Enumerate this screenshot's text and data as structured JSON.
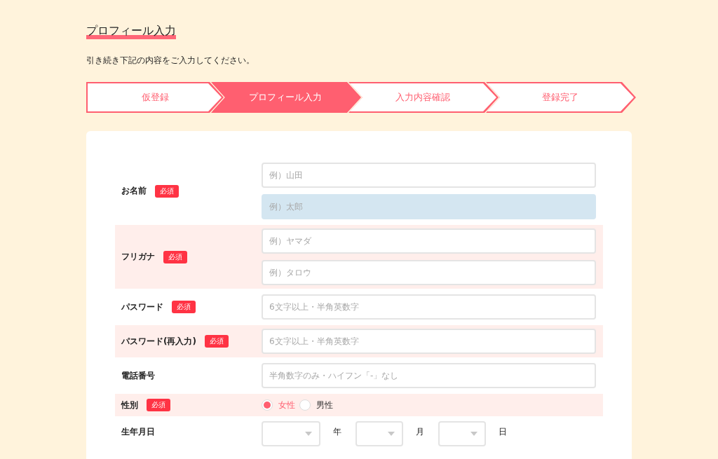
{
  "heading": "プロフィール入力",
  "intro": "引き続き下記の内容をご入力してください。",
  "steps": [
    {
      "label": "仮登録",
      "selected": false
    },
    {
      "label": "プロフィール入力",
      "selected": true
    },
    {
      "label": "入力内容確認",
      "selected": false
    },
    {
      "label": "登録完了",
      "selected": false
    }
  ],
  "form": {
    "rows": [
      {
        "kind": "text",
        "label": "お名前",
        "required_badge": "必須",
        "fields": [
          {
            "placeholder": "例）山田",
            "focused": false
          },
          {
            "placeholder": "例）太郎",
            "focused": true
          }
        ]
      },
      {
        "kind": "text",
        "label": "フリガナ",
        "required_badge": "必須",
        "fields": [
          {
            "placeholder": "例）ヤマダ",
            "focused": false
          },
          {
            "placeholder": "例）タロウ",
            "focused": false
          }
        ]
      },
      {
        "kind": "text",
        "label": "パスワード",
        "required_badge": "必須",
        "fields": [
          {
            "placeholder": "6文字以上・半角英数字",
            "focused": false
          }
        ]
      },
      {
        "kind": "text",
        "label": "パスワード(再入力)",
        "required_badge": "必須",
        "fields": [
          {
            "placeholder": "6文字以上・半角英数字",
            "focused": false
          }
        ]
      },
      {
        "kind": "text",
        "label": "電話番号",
        "fields": [
          {
            "placeholder": "半角数字のみ・ハイフン「-」なし",
            "focused": false
          }
        ]
      },
      {
        "kind": "radio",
        "label": "性別",
        "required_badge": "必須",
        "options": [
          {
            "label": "女性",
            "selected": true
          },
          {
            "label": "男性",
            "selected": false
          }
        ]
      },
      {
        "kind": "date",
        "label": "生年月日",
        "units": [
          "年",
          "月",
          "日"
        ]
      }
    ]
  }
}
